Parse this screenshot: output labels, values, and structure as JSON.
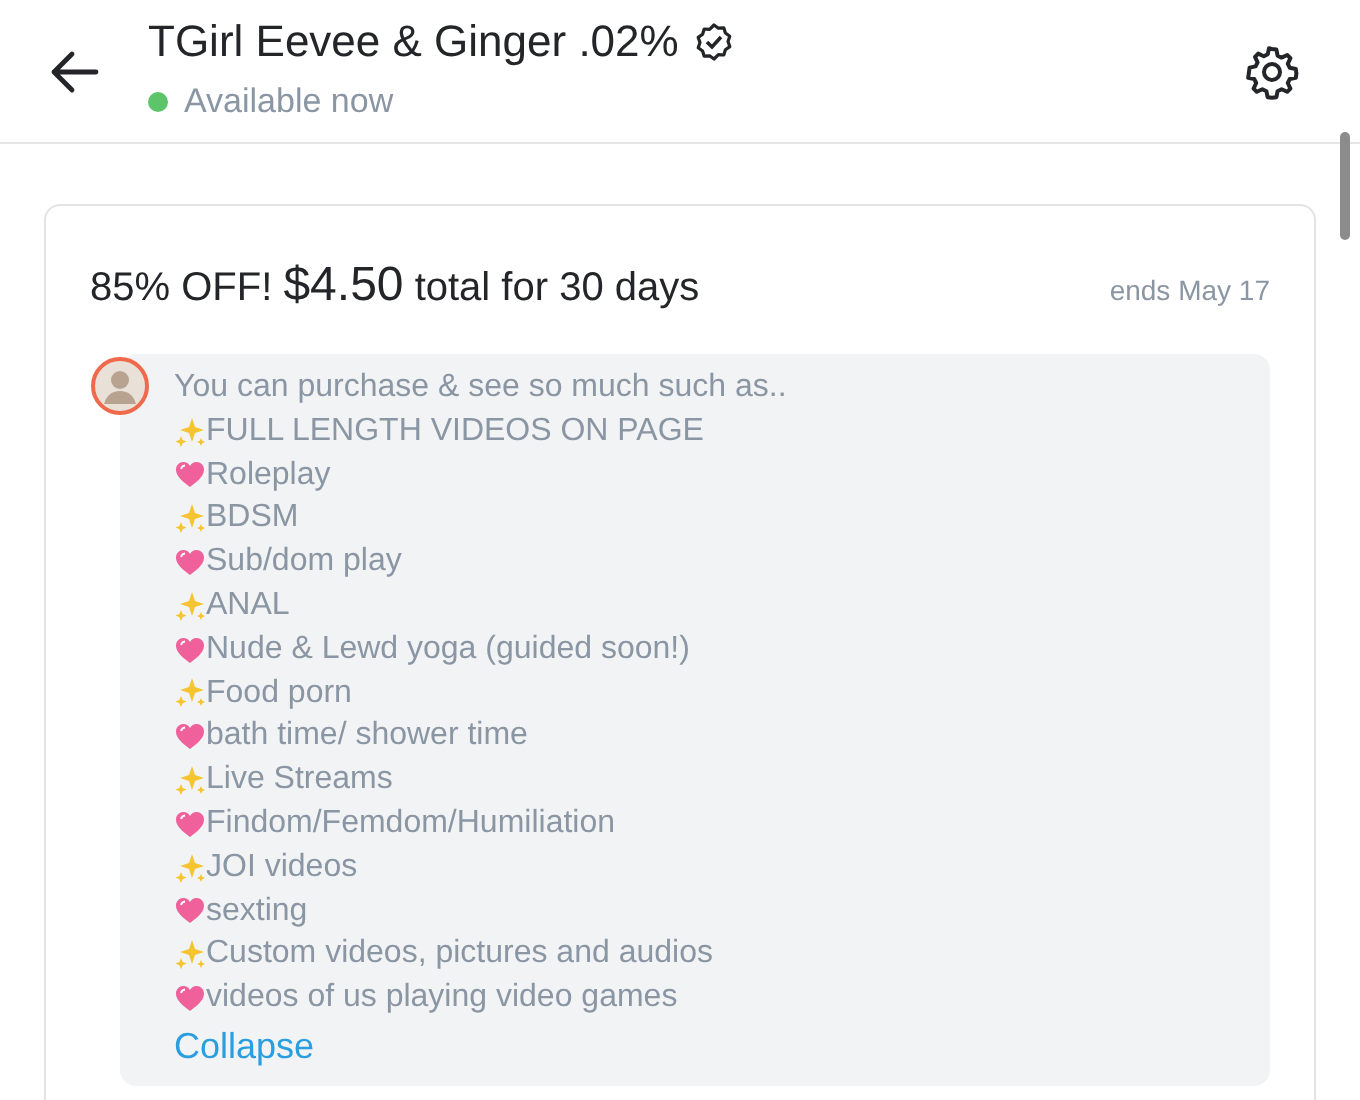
{
  "header": {
    "title": "TGirl Eevee & Ginger .02%",
    "status": {
      "text": "Available now",
      "online": true
    }
  },
  "offer": {
    "discount": "85% OFF!",
    "price": "$4.50",
    "rest": "total for 30 days",
    "ends": "ends May 17"
  },
  "message": {
    "intro": "You can purchase & see so much such as..",
    "items": [
      {
        "kind": "sparkles",
        "text": "FULL LENGTH VIDEOS ON PAGE"
      },
      {
        "kind": "heart",
        "text": "Roleplay"
      },
      {
        "kind": "sparkles",
        "text": "BDSM"
      },
      {
        "kind": "heart",
        "text": "Sub/dom play"
      },
      {
        "kind": "sparkles",
        "text": "ANAL"
      },
      {
        "kind": "heart",
        "text": "Nude & Lewd yoga (guided soon!)"
      },
      {
        "kind": "sparkles",
        "text": "Food porn"
      },
      {
        "kind": "heart",
        "text": "bath time/ shower time"
      },
      {
        "kind": "sparkles",
        "text": "Live Streams"
      },
      {
        "kind": "heart",
        "text": "Findom/Femdom/Humiliation"
      },
      {
        "kind": "sparkles",
        "text": "JOI videos"
      },
      {
        "kind": "heart",
        "text": "sexting"
      },
      {
        "kind": "sparkles",
        "text": "Custom videos, pictures and audios"
      },
      {
        "kind": "heart",
        "text": "videos of us playing video games"
      }
    ],
    "collapse": "Collapse"
  }
}
